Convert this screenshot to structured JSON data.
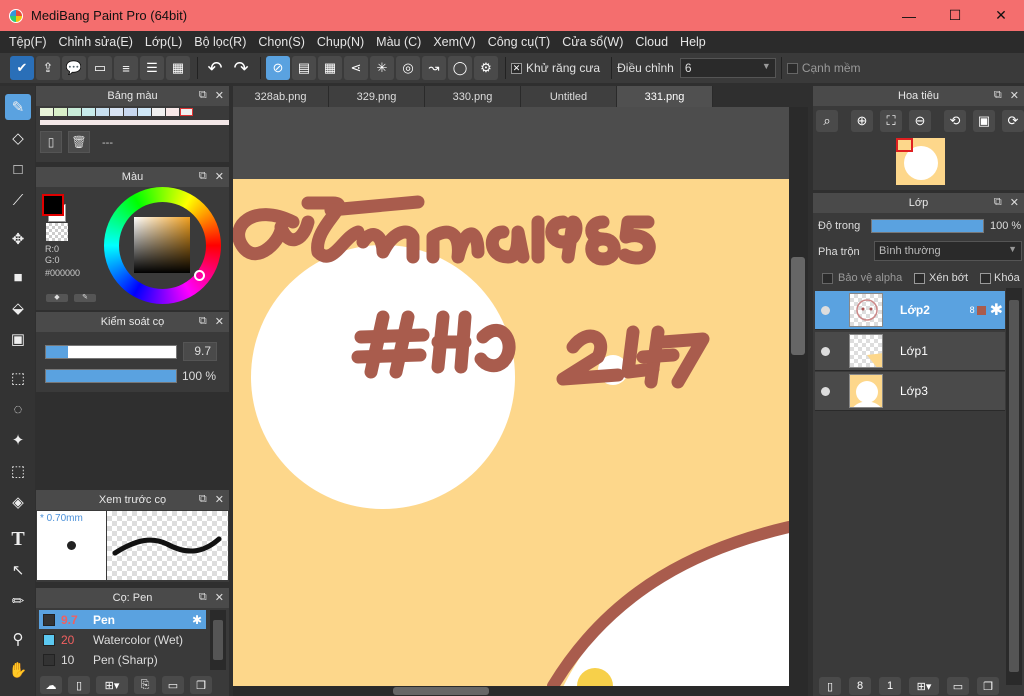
{
  "window": {
    "title": "MediBang Paint Pro (64bit)",
    "minimize": "—",
    "maximize": "☐",
    "close": "✕"
  },
  "menu": [
    "Tệp(F)",
    "Chỉnh sửa(E)",
    "Lớp(L)",
    "Bộ lọc(R)",
    "Chọn(S)",
    "Chụp(N)",
    "Màu (C)",
    "Xem(V)",
    "Công cụ(T)",
    "Cửa sổ(W)",
    "Cloud",
    "Help"
  ],
  "toolbar": {
    "antialias_label": "Khử răng cưa",
    "adjust_label": "Điều chỉnh",
    "adjust_value": "6",
    "soft_edge_label": "Cạnh mềm"
  },
  "palette": {
    "title": "Bảng màu",
    "current": "---"
  },
  "color": {
    "title": "Màu",
    "r": "R:0",
    "g": "G:0",
    "hex": "#000000",
    "fg": "#000000",
    "bg": "#ffffff"
  },
  "brush_control": {
    "title": "Kiểm soát cọ",
    "size": "9.7",
    "opacity": "100 %",
    "size_fraction": 0.17,
    "opacity_fraction": 1.0
  },
  "brush_preview": {
    "title": "Xem trước cọ",
    "size_label": "* 0.70mm"
  },
  "brush_list": {
    "title": "Cọ: Pen",
    "items": [
      {
        "size": "9.7",
        "name": "Pen",
        "color": "#333333",
        "active": true
      },
      {
        "size": "20",
        "name": "Watercolor (Wet)",
        "color": "#5bc8f0",
        "active": false
      },
      {
        "size": "10",
        "name": "Pen (Sharp)",
        "color": "#333333",
        "active": false
      }
    ]
  },
  "tabs": [
    "328ab.png",
    "329.png",
    "330.png",
    "Untitled",
    "331.png"
  ],
  "active_tab": 4,
  "navigator": {
    "title": "Hoa tiêu"
  },
  "layers": {
    "title": "Lớp",
    "opacity_label": "Độ trong",
    "opacity_value": "100 %",
    "opacity_fraction": 1.0,
    "blend_label": "Pha trộn",
    "blend_value": "Bình thường",
    "protect_alpha": "Bảo vệ alpha",
    "clipping": "Xén bớt",
    "lock": "Khóa",
    "items": [
      {
        "name": "Lớp2",
        "active": true,
        "badge": "8"
      },
      {
        "name": "Lớp1",
        "active": false,
        "badge": ""
      },
      {
        "name": "Lớp3",
        "active": false,
        "badge": ""
      }
    ]
  },
  "colors": {
    "canvas_bg": "#fdd78b",
    "stroke": "#a95c4d",
    "accent": "#5aa2e0"
  }
}
